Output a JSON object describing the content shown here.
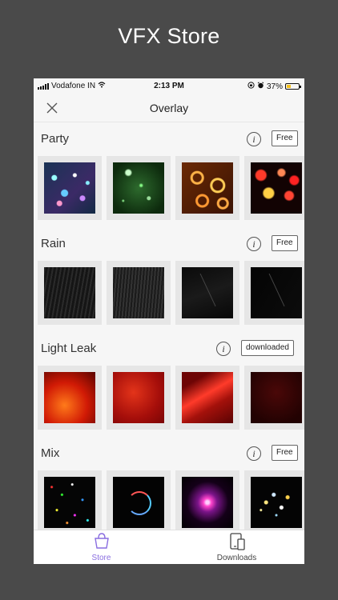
{
  "promo": {
    "title": "VFX Store"
  },
  "status_bar": {
    "carrier": "Vodafone IN",
    "time": "2:13 PM",
    "battery": "37%",
    "battery_level": 0.37
  },
  "nav": {
    "title": "Overlay",
    "close_icon": "close-icon"
  },
  "sections": [
    {
      "title": "Party",
      "badge": "Free",
      "info_icon": "info-icon"
    },
    {
      "title": "Rain",
      "badge": "Free",
      "info_icon": "info-icon"
    },
    {
      "title": "Light Leak",
      "badge": "downloaded",
      "info_icon": "info-icon"
    },
    {
      "title": "Mix",
      "badge": "Free",
      "info_icon": "info-icon"
    }
  ],
  "tabs": [
    {
      "label": "Store",
      "icon": "shopping-bag-icon",
      "active": true,
      "color": "#8a6ee0"
    },
    {
      "label": "Downloads",
      "icon": "devices-icon",
      "active": false,
      "color": "#444444"
    }
  ]
}
